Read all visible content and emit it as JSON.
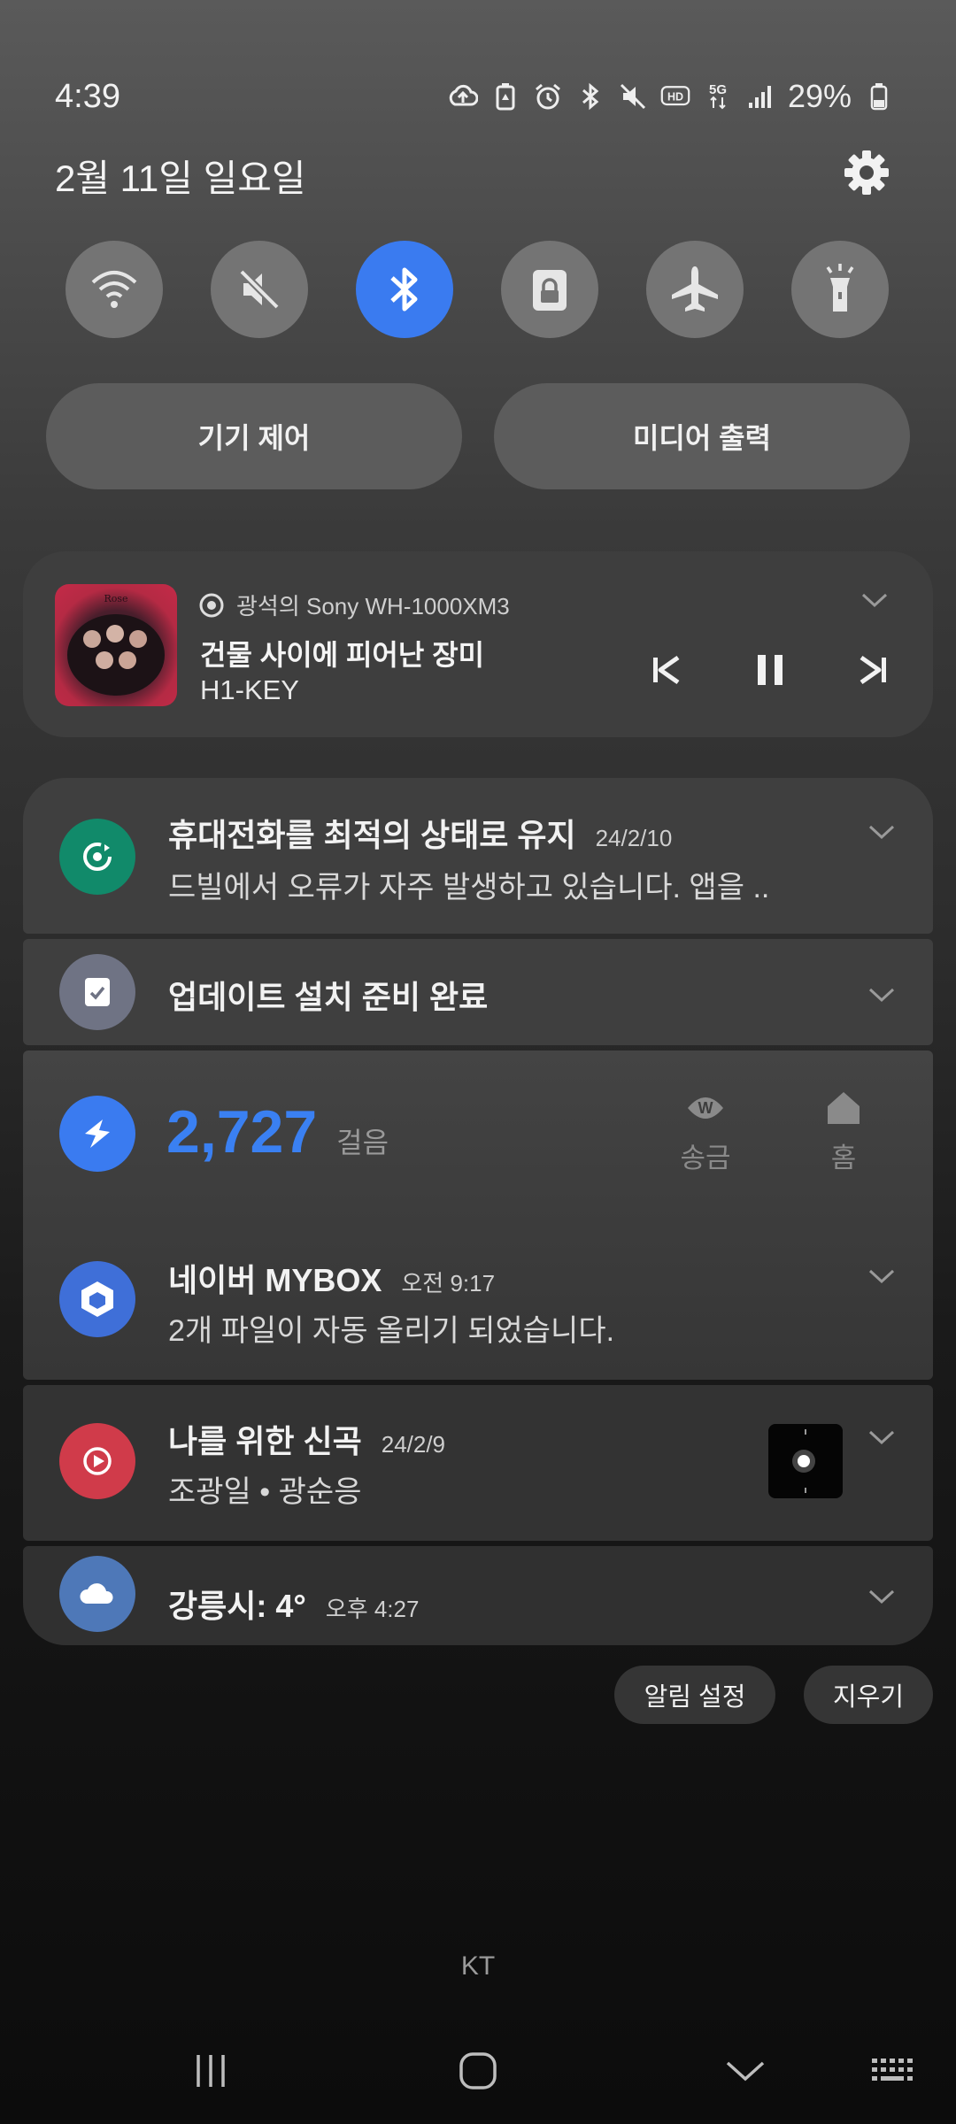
{
  "status_bar": {
    "time": "4:39",
    "battery": "29%",
    "icons": [
      "cloud-upload-icon",
      "battery-saver-icon",
      "alarm-icon",
      "bluetooth-icon",
      "mute-icon",
      "hd-voice-icon",
      "5g-icon",
      "signal-icon",
      "battery-icon"
    ]
  },
  "header": {
    "date": "2월 11일 일요일"
  },
  "quick_toggles": [
    {
      "name": "wifi",
      "active": false
    },
    {
      "name": "mute",
      "active": false
    },
    {
      "name": "bluetooth",
      "active": true
    },
    {
      "name": "secure-folder",
      "active": false
    },
    {
      "name": "airplane",
      "active": false
    },
    {
      "name": "flashlight",
      "active": false
    }
  ],
  "pills": {
    "device_control": "기기 제어",
    "media_output": "미디어 출력"
  },
  "media": {
    "source": "광석의 Sony WH-1000XM3",
    "title": "건물 사이에 피어난 장미",
    "artist": "H1-KEY"
  },
  "notifications": [
    {
      "title": "휴대전화를 최적의 상태로 유지",
      "meta": "24/2/10",
      "body": "드빌에서 오류가 자주 발생하고 있습니다. 앱을 ..",
      "icon_color": "#118a6a"
    },
    {
      "title": "업데이트 설치 준비 완료",
      "icon_color": "#6f7384"
    },
    {
      "steps": "2,727",
      "steps_unit": "걸음",
      "action1": "송금",
      "action2": "홈",
      "icon_color": "#3a7bf0"
    },
    {
      "title": "네이버 MYBOX",
      "meta": "오전 9:17",
      "body": "2개 파일이 자동 올리기 되었습니다.",
      "icon_color": "#3f6fd8"
    },
    {
      "title": "나를 위한 신곡",
      "meta": "24/2/9",
      "body": "조광일 • 광순응",
      "icon_color": "#d03b4a"
    },
    {
      "title": "강릉시: 4°",
      "meta": "오후 4:27",
      "icon_color": "#4e78b8"
    }
  ],
  "footer_buttons": {
    "notif_settings": "알림 설정",
    "clear": "지우기"
  },
  "carrier": "KT"
}
